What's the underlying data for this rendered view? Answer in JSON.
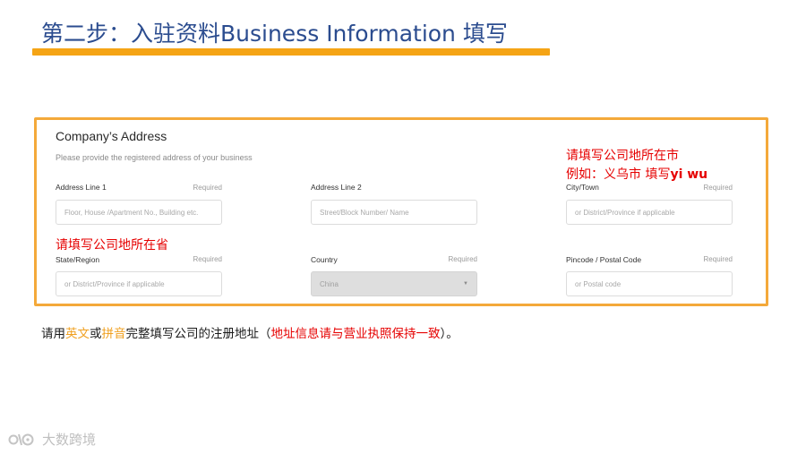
{
  "slide": {
    "title": "第二步：入驻资料Business Information 填写"
  },
  "form": {
    "section_title": "Company’s Address",
    "section_desc": "Please provide the registered address of your business",
    "fields": {
      "address_line1": {
        "label": "Address Line 1",
        "required": "Required",
        "placeholder": "Floor, House /Apartment No., Building etc.",
        "value": ""
      },
      "address_line2": {
        "label": "Address Line 2",
        "required": "",
        "placeholder": "Street/Block Number/ Name",
        "value": ""
      },
      "city": {
        "label": "City/Town",
        "required": "Required",
        "placeholder": "or District/Province if applicable",
        "value": ""
      },
      "state": {
        "label": "State/Region",
        "required": "Required",
        "placeholder": "or District/Province if applicable",
        "value": ""
      },
      "country": {
        "label": "Country",
        "required": "Required",
        "selected": "China",
        "disabled": true
      },
      "pincode": {
        "label": "Pincode / Postal Code",
        "required": "Required",
        "placeholder": "or Postal code",
        "value": ""
      }
    }
  },
  "annotations": {
    "city_line1": "请填写公司地所在市",
    "city_line2_prefix": "例如：义乌市 填写",
    "city_line2_latin": "yi wu",
    "state": "请填写公司地所在省"
  },
  "note": {
    "p1": "请用",
    "hl1": "英文",
    "p2": "或",
    "hl2": "拼音",
    "p3": "完整填写公司的注册地址（",
    "hl3": "地址信息请与营业执照保持一致",
    "p4": "）。"
  },
  "watermark": {
    "text": "大数跨境",
    "icon": "brand-logo-icon"
  },
  "colors": {
    "title": "#2b4c8f",
    "accent_orange": "#f5a415",
    "frame_border": "#f4a93a",
    "annotation_red": "#e60000"
  }
}
